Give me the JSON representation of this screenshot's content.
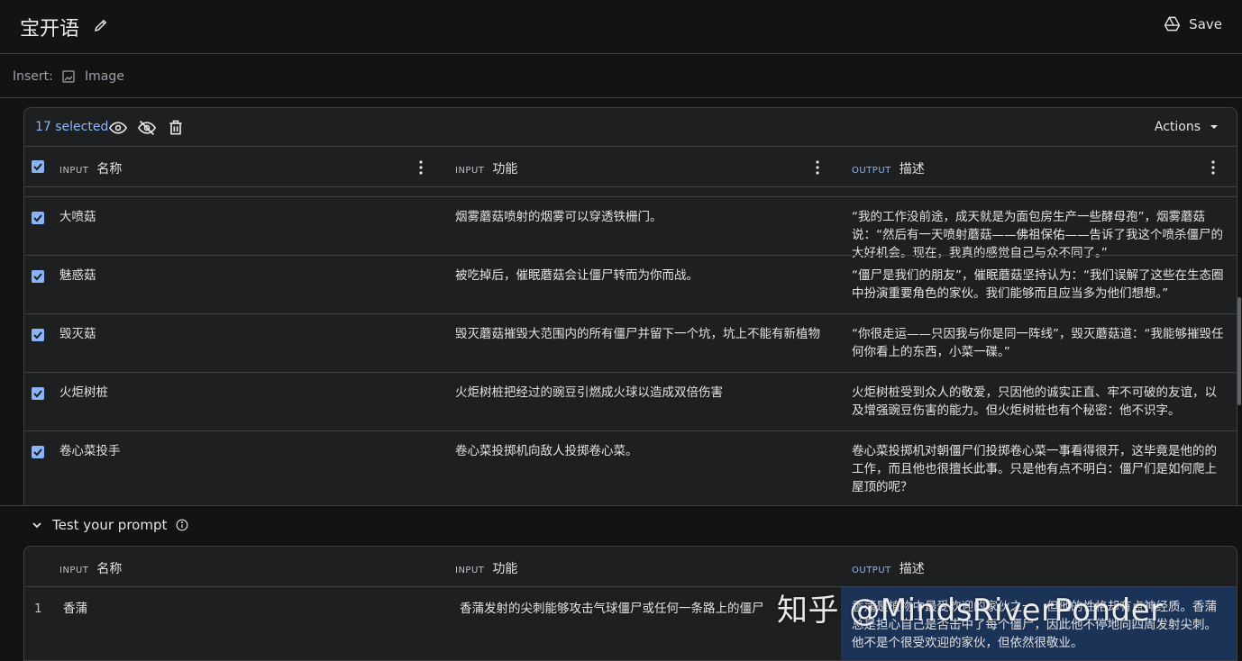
{
  "header": {
    "title": "宝开语",
    "save_label": "Save"
  },
  "insert": {
    "label": "Insert:",
    "image_label": "Image"
  },
  "toolbar": {
    "selected_label": "17 selected",
    "actions_label": "Actions"
  },
  "columns": [
    {
      "tag": "INPUT",
      "name": "名称"
    },
    {
      "tag": "INPUT",
      "name": "功能"
    },
    {
      "tag": "OUTPUT",
      "name": "描述"
    }
  ],
  "rows": [
    {
      "checked": true,
      "name": "大喷菇",
      "function": "烟雾蘑菇喷射的烟雾可以穿透铁栅门。",
      "description": "“我的工作没前途，成天就是为面包房生产一些酵母孢”，烟雾蘑菇说：“然后有一天喷射蘑菇——佛祖保佑——告诉了我这个喷杀僵尸的大好机会。现在，我真的感觉自己与众不同了。”"
    },
    {
      "checked": true,
      "name": "魅惑菇",
      "function": "被吃掉后，催眠蘑菇会让僵尸转而为你而战。",
      "description": "“僵尸是我们的朋友”，催眠蘑菇坚持认为：“我们误解了这些在生态圈中扮演重要角色的家伙。我们能够而且应当多为他们想想。”"
    },
    {
      "checked": true,
      "name": "毁灭菇",
      "function": "毁灭蘑菇摧毁大范围内的所有僵尸并留下一个坑，坑上不能有新植物",
      "description": "“你很走运——只因我与你是同一阵线”，毁灭蘑菇道：“我能够摧毁任何你看上的东西，小菜一碟。”"
    },
    {
      "checked": true,
      "name": "火炬树桩",
      "function": "火炬树桩把经过的豌豆引燃成火球以造成双倍伤害",
      "description": "火炬树桩受到众人的敬爱，只因他的诚实正直、牢不可破的友谊，以及增强豌豆伤害的能力。但火炬树桩也有个秘密：他不识字。"
    },
    {
      "checked": true,
      "name": "卷心菜投手",
      "function": "卷心菜投掷机向敌人投掷卷心菜。",
      "description": "卷心菜投掷机对朝僵尸们投掷卷心菜一事看得很开，这毕竟是他的的工作，而且他也很擅长此事。只是他有点不明白：僵尸们是如何爬上屋顶的呢？"
    }
  ],
  "test": {
    "title": "Test your prompt",
    "row_index": "1",
    "name": "香蒲",
    "function": "香蒲发射的尖刺能够攻击气球僵尸或任何一条路上的僵尸",
    "output": "香蒲是植物中最受欢迎的家伙之一，但他的性格却有点神经质。香蒲总是担心自己是否击中了每个僵尸，因此他不停地向四周发射尖刺。他不是个很受欢迎的家伙，但依然很敬业。"
  },
  "watermark": "知乎 @MindsRiverPonder",
  "colors": {
    "background": "#131314",
    "panel": "#1e1f20",
    "accent": "#8ab4f8",
    "output_highlight": "#1c3358"
  }
}
